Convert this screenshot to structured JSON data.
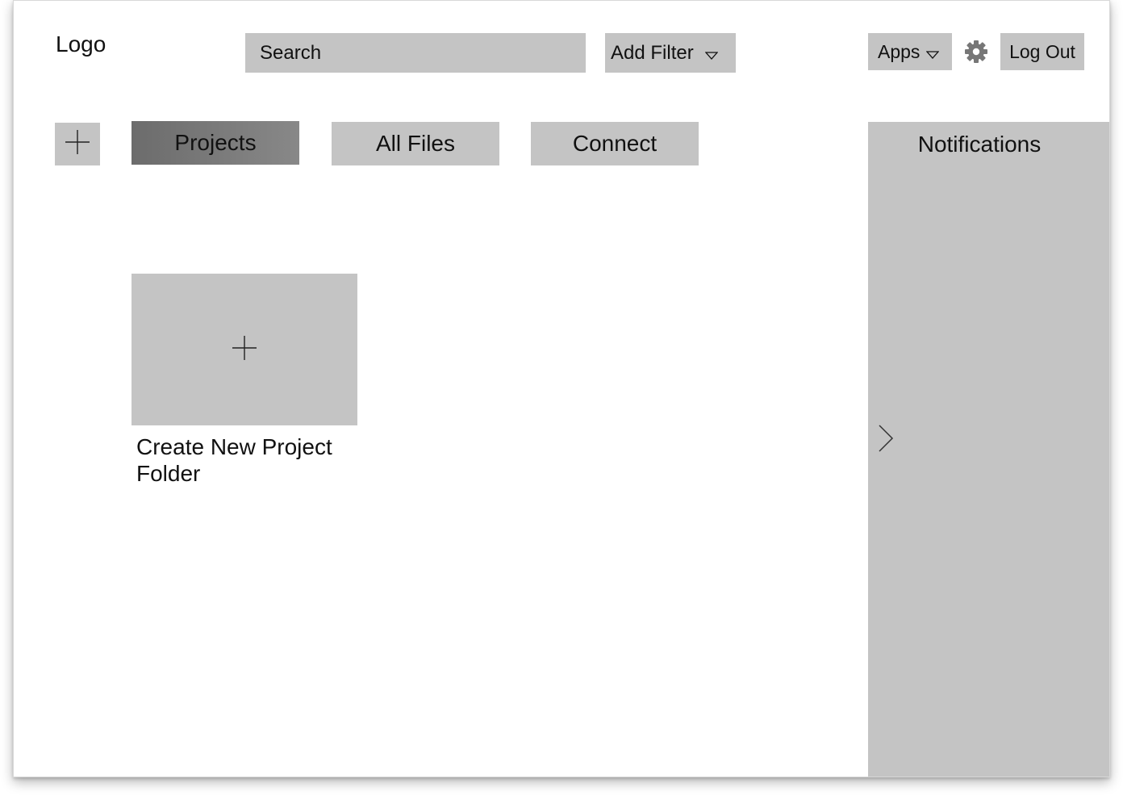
{
  "header": {
    "logo": "Logo",
    "search": {
      "placeholder": "Search",
      "value": ""
    },
    "filter_label": "Add Filter",
    "apps_label": "Apps",
    "settings_icon": "gear-icon",
    "logout_label": "Log Out"
  },
  "tabs": [
    {
      "label": "Projects",
      "active": true
    },
    {
      "label": "All Files",
      "active": false
    },
    {
      "label": "Connect",
      "active": false
    }
  ],
  "add_icon": "plus-icon",
  "main": {
    "create_card": {
      "icon": "plus-icon",
      "label": "Create New Project Folder"
    }
  },
  "notifications": {
    "title": "Notifications",
    "toggle_icon": "chevron-right-icon"
  },
  "colors": {
    "control_bg": "#c4c4c4",
    "active_tab_bg": "#777777",
    "text": "#111111",
    "page_bg": "#ffffff"
  }
}
